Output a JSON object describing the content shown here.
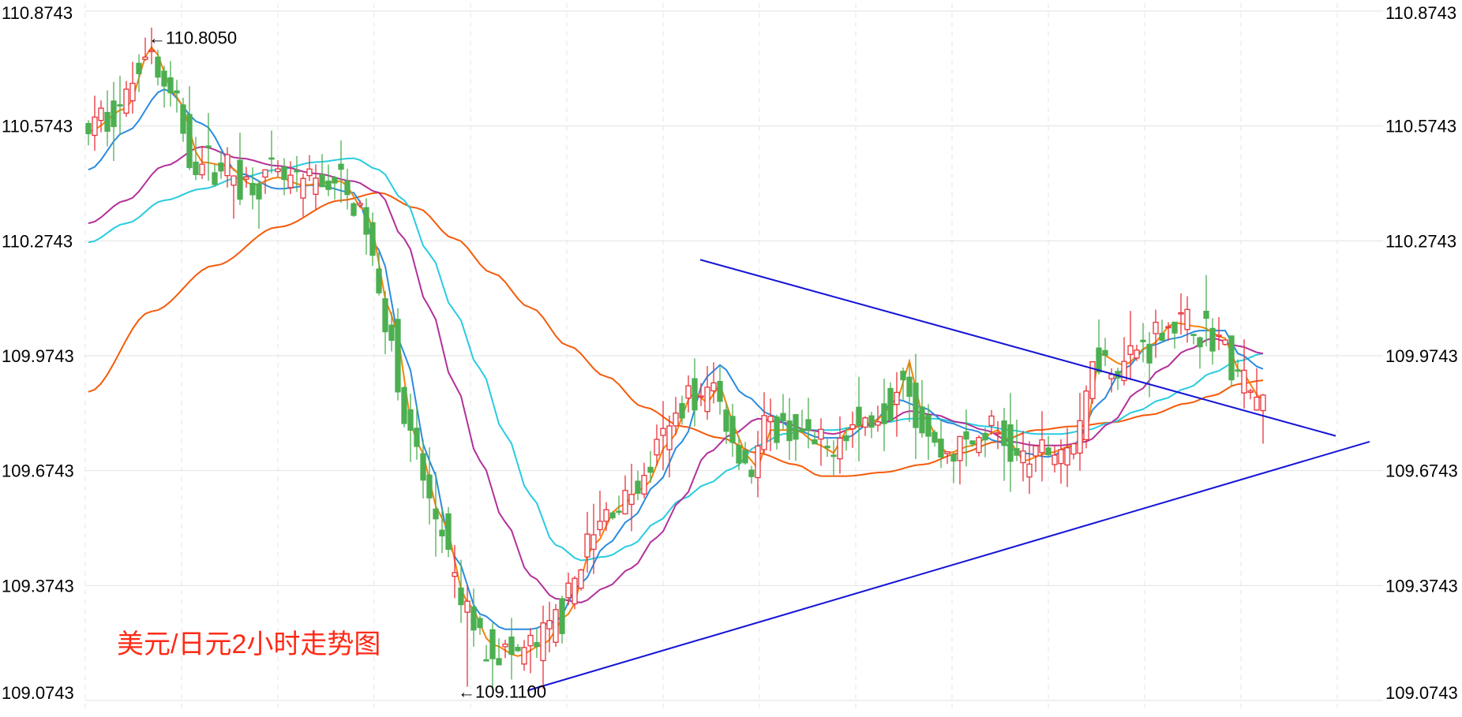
{
  "chart_data": {
    "type": "candlestick",
    "title": "美元/日元2小时走势图",
    "y_axis": {
      "ticks": [
        "110.8743",
        "110.5743",
        "110.2743",
        "109.9743",
        "109.6743",
        "109.3743",
        "109.0743"
      ],
      "tick_values": [
        110.8743,
        110.5743,
        110.2743,
        109.9743,
        109.6743,
        109.3743,
        109.0743
      ],
      "ylim": [
        109.0743,
        110.8743
      ]
    },
    "grid": true,
    "annotations": {
      "high": {
        "text": "←110.8050",
        "value": 110.805
      },
      "low": {
        "text": "←109.1100",
        "value": 109.11
      }
    },
    "colors": {
      "up": "#e8333a",
      "down": "#4caf50",
      "ma_fast": "#f5820a",
      "ma_blue": "#2a8be0",
      "ma_purple": "#b3309b",
      "ma_cyan": "#28cce0",
      "ma_long": "#f55a0a",
      "trendline": "#1414d8",
      "title": "#ff2a16"
    },
    "series_trend_anchors": {
      "ma_fast": [
        [
          0,
          110.56
        ],
        [
          6,
          110.62
        ],
        [
          10,
          110.78
        ],
        [
          14,
          110.65
        ],
        [
          18,
          110.48
        ],
        [
          22,
          110.47
        ],
        [
          26,
          110.42
        ],
        [
          30,
          110.44
        ],
        [
          34,
          110.42
        ],
        [
          40,
          110.43
        ],
        [
          44,
          110.35
        ],
        [
          48,
          110.08
        ],
        [
          52,
          109.75
        ],
        [
          56,
          109.55
        ],
        [
          60,
          109.33
        ],
        [
          64,
          109.22
        ],
        [
          68,
          109.19
        ],
        [
          72,
          109.22
        ],
        [
          76,
          109.3
        ],
        [
          80,
          109.48
        ],
        [
          84,
          109.58
        ],
        [
          88,
          109.63
        ],
        [
          92,
          109.75
        ],
        [
          96,
          109.88
        ],
        [
          98,
          109.85
        ],
        [
          100,
          109.9
        ],
        [
          102,
          109.8
        ],
        [
          104,
          109.72
        ],
        [
          106,
          109.68
        ],
        [
          108,
          109.78
        ],
        [
          112,
          109.78
        ],
        [
          116,
          109.74
        ],
        [
          118,
          109.72
        ],
        [
          120,
          109.78
        ],
        [
          124,
          109.8
        ],
        [
          128,
          109.85
        ],
        [
          130,
          109.96
        ],
        [
          132,
          109.82
        ],
        [
          136,
          109.72
        ],
        [
          140,
          109.74
        ],
        [
          144,
          109.78
        ],
        [
          146,
          109.75
        ],
        [
          148,
          109.7
        ],
        [
          152,
          109.72
        ],
        [
          156,
          109.74
        ],
        [
          158,
          109.76
        ],
        [
          160,
          109.98
        ],
        [
          164,
          109.95
        ],
        [
          168,
          110.0
        ],
        [
          172,
          110.06
        ],
        [
          176,
          110.05
        ],
        [
          180,
          110.02
        ],
        [
          182,
          109.94
        ],
        [
          186,
          109.86
        ]
      ],
      "ma_blue": [
        [
          0,
          110.46
        ],
        [
          6,
          110.56
        ],
        [
          12,
          110.67
        ],
        [
          18,
          110.58
        ],
        [
          24,
          110.45
        ],
        [
          30,
          110.41
        ],
        [
          36,
          110.42
        ],
        [
          42,
          110.4
        ],
        [
          46,
          110.25
        ],
        [
          50,
          109.98
        ],
        [
          54,
          109.7
        ],
        [
          58,
          109.45
        ],
        [
          62,
          109.3
        ],
        [
          66,
          109.26
        ],
        [
          70,
          109.26
        ],
        [
          74,
          109.28
        ],
        [
          78,
          109.38
        ],
        [
          82,
          109.48
        ],
        [
          86,
          109.55
        ],
        [
          90,
          109.64
        ],
        [
          94,
          109.75
        ],
        [
          98,
          109.92
        ],
        [
          100,
          109.95
        ],
        [
          104,
          109.87
        ],
        [
          108,
          109.82
        ],
        [
          112,
          109.78
        ],
        [
          116,
          109.76
        ],
        [
          120,
          109.76
        ],
        [
          124,
          109.8
        ],
        [
          128,
          109.86
        ],
        [
          132,
          109.84
        ],
        [
          136,
          109.8
        ],
        [
          140,
          109.78
        ],
        [
          144,
          109.75
        ],
        [
          148,
          109.72
        ],
        [
          152,
          109.71
        ],
        [
          156,
          109.74
        ],
        [
          160,
          109.85
        ],
        [
          164,
          109.94
        ],
        [
          168,
          110.0
        ],
        [
          172,
          110.02
        ],
        [
          176,
          110.04
        ],
        [
          180,
          110.04
        ],
        [
          182,
          109.98
        ],
        [
          186,
          109.94
        ]
      ],
      "ma_purple": [
        [
          0,
          110.32
        ],
        [
          6,
          110.38
        ],
        [
          12,
          110.47
        ],
        [
          18,
          110.52
        ],
        [
          24,
          110.49
        ],
        [
          30,
          110.47
        ],
        [
          36,
          110.45
        ],
        [
          42,
          110.43
        ],
        [
          46,
          110.4
        ],
        [
          50,
          110.28
        ],
        [
          54,
          110.1
        ],
        [
          58,
          109.9
        ],
        [
          62,
          109.7
        ],
        [
          66,
          109.54
        ],
        [
          70,
          109.4
        ],
        [
          74,
          109.34
        ],
        [
          78,
          109.33
        ],
        [
          82,
          109.37
        ],
        [
          86,
          109.42
        ],
        [
          90,
          109.5
        ],
        [
          94,
          109.6
        ],
        [
          98,
          109.72
        ],
        [
          102,
          109.77
        ],
        [
          106,
          109.81
        ],
        [
          110,
          109.8
        ],
        [
          114,
          109.78
        ],
        [
          118,
          109.77
        ],
        [
          122,
          109.79
        ],
        [
          126,
          109.8
        ],
        [
          130,
          109.83
        ],
        [
          134,
          109.82
        ],
        [
          138,
          109.8
        ],
        [
          142,
          109.78
        ],
        [
          146,
          109.75
        ],
        [
          150,
          109.74
        ],
        [
          154,
          109.74
        ],
        [
          158,
          109.75
        ],
        [
          162,
          109.8
        ],
        [
          166,
          109.88
        ],
        [
          170,
          109.94
        ],
        [
          174,
          109.99
        ],
        [
          178,
          110.02
        ],
        [
          182,
          110.0
        ],
        [
          186,
          109.98
        ]
      ],
      "ma_cyan": [
        [
          0,
          110.27
        ],
        [
          6,
          110.32
        ],
        [
          12,
          110.38
        ],
        [
          18,
          110.41
        ],
        [
          24,
          110.44
        ],
        [
          30,
          110.46
        ],
        [
          36,
          110.48
        ],
        [
          42,
          110.49
        ],
        [
          46,
          110.46
        ],
        [
          50,
          110.38
        ],
        [
          54,
          110.24
        ],
        [
          58,
          110.09
        ],
        [
          62,
          109.94
        ],
        [
          66,
          109.77
        ],
        [
          70,
          109.61
        ],
        [
          74,
          109.48
        ],
        [
          78,
          109.44
        ],
        [
          82,
          109.45
        ],
        [
          86,
          109.48
        ],
        [
          90,
          109.54
        ],
        [
          94,
          109.6
        ],
        [
          98,
          109.64
        ],
        [
          102,
          109.68
        ],
        [
          106,
          109.74
        ],
        [
          110,
          109.77
        ],
        [
          114,
          109.78
        ],
        [
          118,
          109.78
        ],
        [
          122,
          109.79
        ],
        [
          126,
          109.8
        ],
        [
          130,
          109.81
        ],
        [
          134,
          109.81
        ],
        [
          138,
          109.8
        ],
        [
          142,
          109.79
        ],
        [
          146,
          109.78
        ],
        [
          150,
          109.77
        ],
        [
          154,
          109.77
        ],
        [
          158,
          109.78
        ],
        [
          162,
          109.8
        ],
        [
          166,
          109.83
        ],
        [
          170,
          109.86
        ],
        [
          174,
          109.89
        ],
        [
          178,
          109.93
        ],
        [
          182,
          109.96
        ],
        [
          186,
          109.98
        ]
      ],
      "ma_long": [
        [
          0,
          109.88
        ],
        [
          10,
          110.09
        ],
        [
          20,
          110.21
        ],
        [
          30,
          110.31
        ],
        [
          40,
          110.38
        ],
        [
          46,
          110.4
        ],
        [
          52,
          110.36
        ],
        [
          58,
          110.28
        ],
        [
          64,
          110.19
        ],
        [
          70,
          110.1
        ],
        [
          76,
          110.0
        ],
        [
          82,
          109.92
        ],
        [
          88,
          109.84
        ],
        [
          94,
          109.79
        ],
        [
          100,
          109.76
        ],
        [
          106,
          109.72
        ],
        [
          112,
          109.69
        ],
        [
          116,
          109.66
        ],
        [
          120,
          109.66
        ],
        [
          126,
          109.67
        ],
        [
          132,
          109.69
        ],
        [
          138,
          109.72
        ],
        [
          144,
          109.75
        ],
        [
          150,
          109.78
        ],
        [
          156,
          109.79
        ],
        [
          162,
          109.8
        ],
        [
          168,
          109.82
        ],
        [
          174,
          109.85
        ],
        [
          178,
          109.87
        ],
        [
          182,
          109.9
        ],
        [
          186,
          109.91
        ]
      ]
    }
  }
}
